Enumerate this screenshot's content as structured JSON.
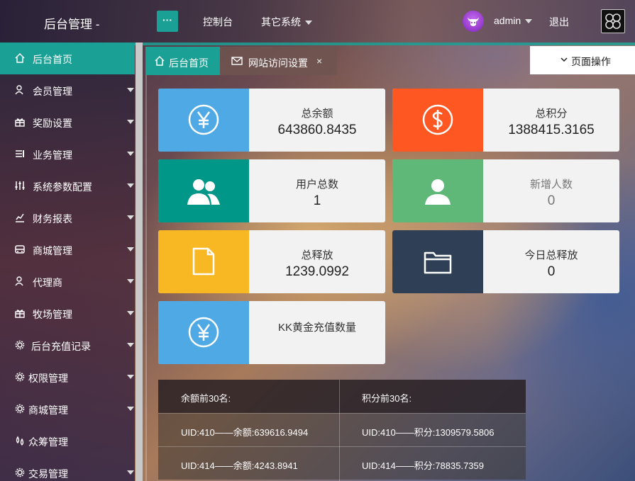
{
  "header": {
    "brand": "后台管理 -",
    "menu_toggle": "···",
    "nav_dashboard": "控制台",
    "nav_other": "其它系统",
    "username": "admin",
    "logout": "退出"
  },
  "sidebar": {
    "items": [
      {
        "label": "后台首页",
        "icon": "home-icon"
      },
      {
        "label": "会员管理",
        "icon": "user-icon"
      },
      {
        "label": "奖励设置",
        "icon": "gift-icon"
      },
      {
        "label": "业务管理",
        "icon": "list-icon"
      },
      {
        "label": "系统参数配置",
        "icon": "sliders-icon"
      },
      {
        "label": "财务报表",
        "icon": "chart-icon"
      },
      {
        "label": "商城管理",
        "icon": "shop-icon"
      },
      {
        "label": "代理商",
        "icon": "user-icon"
      },
      {
        "label": "牧场管理",
        "icon": "gift-icon"
      },
      {
        "label": "后台充值记录",
        "icon": "gear-icon"
      },
      {
        "label": "权限管理",
        "icon": "gear-icon"
      },
      {
        "label": "商城管理",
        "icon": "gear-icon"
      },
      {
        "label": "众筹管理",
        "icon": "drops-icon"
      },
      {
        "label": "交易管理",
        "icon": "gear-icon"
      }
    ]
  },
  "tabs": {
    "home": "后台首页",
    "site": "网站访问设置",
    "close": "×",
    "page_ops": "页面操作"
  },
  "cards": [
    {
      "title": "总余额",
      "value": "643860.8435",
      "color": "#4fa9e4",
      "icon": "yen-icon"
    },
    {
      "title": "总积分",
      "value": "1388415.3165",
      "color": "#ff5722",
      "icon": "dollar-icon"
    },
    {
      "title": "用户总数",
      "value": "1",
      "color": "#009688",
      "icon": "users-icon"
    },
    {
      "title": "新增人数",
      "value": "0",
      "color": "#5fb878",
      "icon": "user-add-icon"
    },
    {
      "title": "总释放",
      "value": "1239.0992",
      "color": "#f7b824",
      "icon": "file-icon"
    },
    {
      "title": "今日总释放",
      "value": "0",
      "color": "#2f4056",
      "icon": "folder-icon"
    },
    {
      "title": "KK黄金充值数量",
      "value": "",
      "color": "#4fa9e4",
      "icon": "yen-icon"
    }
  ],
  "rank_table": {
    "headers": [
      "余额前30名:",
      "积分前30名:"
    ],
    "rows": [
      [
        "UID:410——余额:639616.9494",
        "UID:410——积分:1309579.5806"
      ],
      [
        "UID:414——余额:4243.8941",
        "UID:414——积分:78835.7359"
      ]
    ]
  }
}
